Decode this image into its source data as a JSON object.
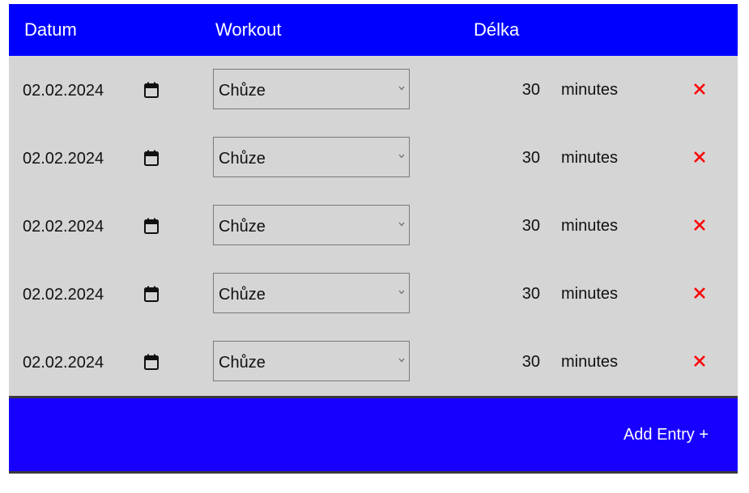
{
  "header": {
    "date_label": "Datum",
    "workout_label": "Workout",
    "length_label": "Délka"
  },
  "entries": [
    {
      "date": "02.02.2024",
      "workout": "Chůze",
      "duration": "30",
      "unit": "minutes"
    },
    {
      "date": "02.02.2024",
      "workout": "Chůze",
      "duration": "30",
      "unit": "minutes"
    },
    {
      "date": "02.02.2024",
      "workout": "Chůze",
      "duration": "30",
      "unit": "minutes"
    },
    {
      "date": "02.02.2024",
      "workout": "Chůze",
      "duration": "30",
      "unit": "minutes"
    },
    {
      "date": "02.02.2024",
      "workout": "Chůze",
      "duration": "30",
      "unit": "minutes"
    }
  ],
  "footer": {
    "add_label": "Add Entry +"
  },
  "colors": {
    "header_bg": "#0000ff",
    "footer_bg": "#1800ff",
    "row_bg": "#d5d5d5",
    "delete": "#ff0000"
  },
  "icons": {
    "calendar": "calendar-icon",
    "dropdown": "chevron-down-icon",
    "delete": "close-icon"
  }
}
